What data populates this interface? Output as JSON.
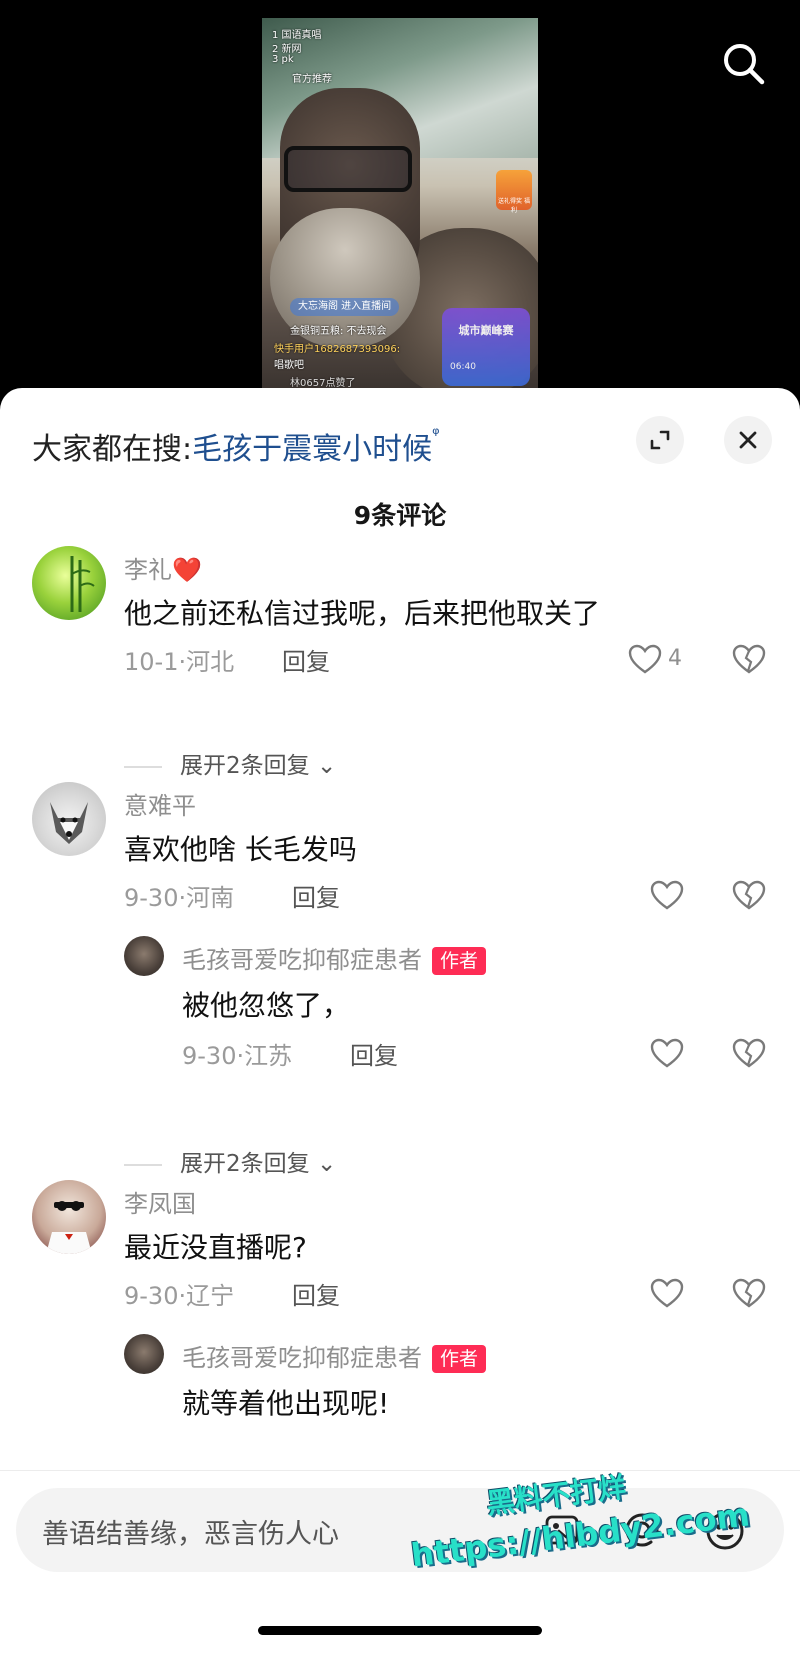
{
  "video": {
    "overlay_lines": [
      "1 国语真唱",
      "2 新网",
      "3 pk"
    ],
    "tag": "官方推荐",
    "enter_notice": "大忘海阁 进入直播间",
    "chat_1": "金银铜五粮: 不去现会",
    "chat_2_user": "快手用户1682687393096:",
    "chat_2_text": "唱歌吧",
    "chat_3": "林0657点赞了",
    "badge_chest": "送礼得奖 福利",
    "badge_live": "城市巅峰赛",
    "badge_live_time": "06:40"
  },
  "top_bar": {
    "search_prefix": "大家都在搜:",
    "search_keyword": "毛孩于震寰小时候",
    "search_glyph": "ᵠ",
    "expand_icon": "expand-icon",
    "close_icon": "close-icon"
  },
  "comment_count": "9条评论",
  "comments": [
    {
      "user": "李礼❤️",
      "text": "他之前还私信过我呢，后来把他取关了",
      "date_loc": "10-1·河北",
      "reply": "回复",
      "likes": "4",
      "expand": "展开2条回复"
    },
    {
      "user": "意难平",
      "text": "喜欢他啥 长毛发吗",
      "date_loc": "9-30·河南",
      "reply": "回复",
      "likes": "",
      "sub": {
        "user": "毛孩哥爱吃抑郁症患者",
        "badge": "作者",
        "text": "被他忽悠了，",
        "date_loc": "9-30·江苏",
        "reply": "回复"
      },
      "expand": "展开2条回复"
    },
    {
      "user": "李凤国",
      "text": "最近没直播呢?",
      "date_loc": "9-30·辽宁",
      "reply": "回复",
      "likes": "",
      "sub": {
        "user": "毛孩哥爱吃抑郁症患者",
        "badge": "作者",
        "text": "就等着他出现呢!",
        "date_loc": "",
        "reply": ""
      }
    }
  ],
  "input": {
    "placeholder": "善语结善缘，恶言伤人心"
  },
  "watermark": {
    "line1": "黑料不打烊",
    "line2": "https://hlbdy2.com"
  },
  "colors": {
    "author_badge": "#fe2c55",
    "keyword": "#1f4f8f",
    "watermark": "#28e0c8"
  }
}
